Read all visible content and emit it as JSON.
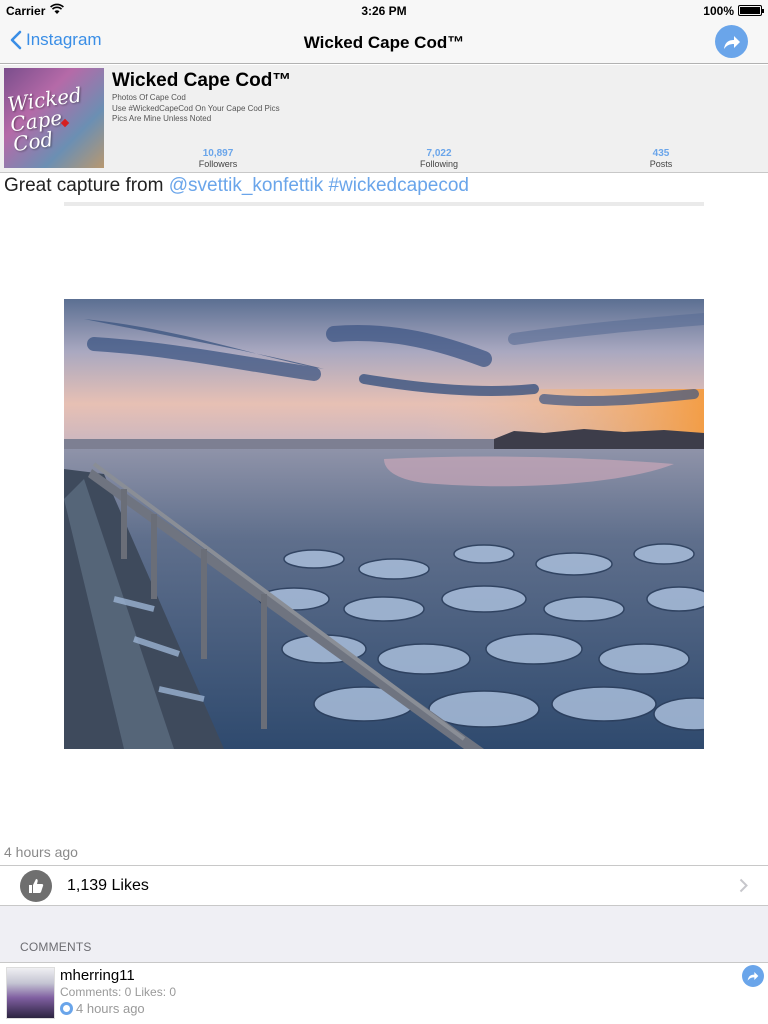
{
  "status_bar": {
    "carrier": "Carrier",
    "time": "3:26 PM",
    "battery": "100%"
  },
  "nav": {
    "back_label": "Instagram",
    "title": "Wicked Cape Cod™",
    "share_icon": "share-arrow-icon"
  },
  "profile": {
    "name": "Wicked Cape Cod™",
    "bio": [
      "Photos Of Cape Cod",
      "Use #WickedCapeCod On Your Cape Cod Pics",
      "Pics Are Mine Unless Noted"
    ],
    "stats": [
      {
        "value": "10,897",
        "label": "Followers"
      },
      {
        "value": "7,022",
        "label": "Following"
      },
      {
        "value": "435",
        "label": "Posts"
      }
    ]
  },
  "post": {
    "caption_prefix": "Great capture from ",
    "mention": "@svettik_konfettik",
    "hashtag": "#wickedcapecod",
    "timestamp": "4 hours ago",
    "likes": "1,139 Likes"
  },
  "comments": {
    "header": "COMMENTS",
    "items": [
      {
        "user": "mherring11",
        "meta": "Comments: 0 Likes: 0",
        "time": "4 hours ago"
      }
    ]
  },
  "colors": {
    "accent": "#6aa5ea",
    "link": "#3a8ee6"
  }
}
